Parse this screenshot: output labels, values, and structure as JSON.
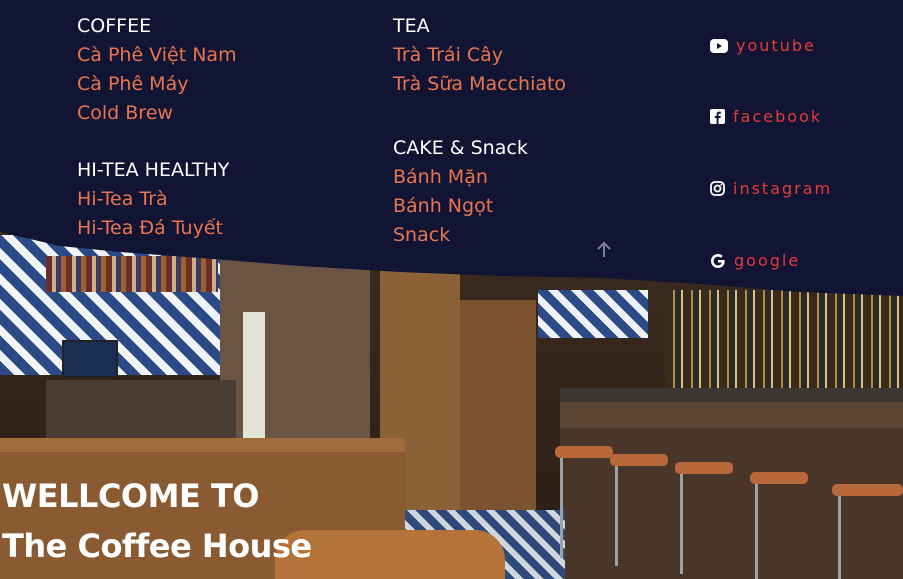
{
  "footer": {
    "col1": {
      "sections": [
        {
          "heading": "COFFEE",
          "links": [
            "Cà Phê Việt Nam",
            "Cà Phê Máy",
            "Cold Brew"
          ]
        },
        {
          "heading": "HI-TEA HEALTHY",
          "links": [
            "Hi-Tea Trà",
            "Hi-Tea Đá Tuyết"
          ]
        }
      ]
    },
    "col2": {
      "sections": [
        {
          "heading": "TEA",
          "links": [
            "Trà Trái Cây",
            "Trà Sữa Macchiato"
          ]
        },
        {
          "heading": "CAKE & Snack",
          "links": [
            "Bánh Mặn",
            "Bánh Ngọt",
            "Snack"
          ]
        }
      ]
    },
    "social": [
      {
        "label": "youtube",
        "icon": "youtube-icon"
      },
      {
        "label": "facebook",
        "icon": "facebook-icon"
      },
      {
        "label": "instagram",
        "icon": "instagram-icon"
      },
      {
        "label": "google",
        "icon": "google-icon"
      }
    ],
    "scroll_top_icon": "arrow-up-icon"
  },
  "hero": {
    "line1": "WELLCOME TO",
    "line2": "The Coffee House"
  },
  "colors": {
    "footer_bg": "#121433",
    "link": "#e8754f",
    "social": "#e23b3b",
    "heading": "#ffffff"
  }
}
